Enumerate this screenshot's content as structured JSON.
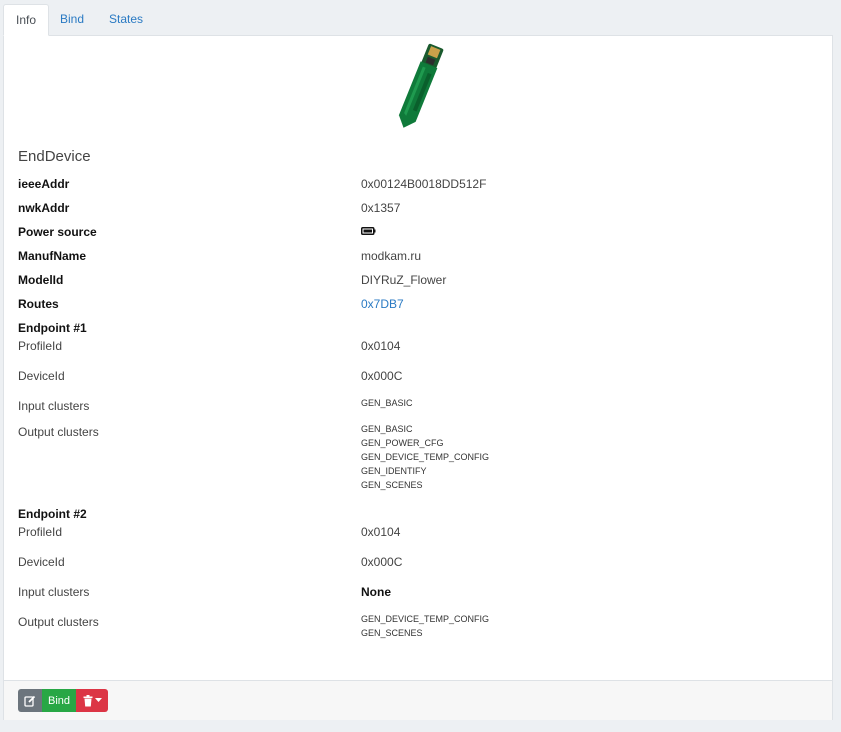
{
  "tabs": [
    {
      "label": "Info"
    },
    {
      "label": "Bind"
    },
    {
      "label": "States"
    }
  ],
  "device": {
    "type": "EndDevice",
    "image_icon": "pcb-soil-sensor-image"
  },
  "fields": {
    "ieeeAddr": {
      "label": "ieeeAddr",
      "value": "0x00124B0018DD512F"
    },
    "nwkAddr": {
      "label": "nwkAddr",
      "value": "0x1357"
    },
    "power_source": {
      "label": "Power source",
      "icon": "battery-icon"
    },
    "manufName": {
      "label": "ManufName",
      "value": "modkam.ru"
    },
    "modelId": {
      "label": "ModelId",
      "value": "DIYRuZ_Flower"
    },
    "routes": {
      "label": "Routes",
      "value": "0x7DB7"
    }
  },
  "endpoints": [
    {
      "title": "Endpoint #1",
      "profile_label": "ProfileId",
      "profile": "0x0104",
      "device_label": "DeviceId",
      "device": "0x000C",
      "input_label": "Input clusters",
      "input": [
        "GEN_BASIC"
      ],
      "output_label": "Output clusters",
      "output": [
        "GEN_BASIC",
        "GEN_POWER_CFG",
        "GEN_DEVICE_TEMP_CONFIG",
        "GEN_IDENTIFY",
        "GEN_SCENES"
      ]
    },
    {
      "title": "Endpoint #2",
      "profile_label": "ProfileId",
      "profile": "0x0104",
      "device_label": "DeviceId",
      "device": "0x000C",
      "input_label": "Input clusters",
      "input_none": "None",
      "output_label": "Output clusters",
      "output": [
        "GEN_DEVICE_TEMP_CONFIG",
        "GEN_SCENES"
      ]
    }
  ],
  "footer": {
    "edit_icon": "edit-icon",
    "bind_label": "Bind",
    "delete_icon": "trash-icon"
  },
  "colors": {
    "link": "#2a7ac3",
    "bind_button": "#28a745",
    "edit_button": "#6c757d",
    "delete_button": "#dc3545"
  }
}
